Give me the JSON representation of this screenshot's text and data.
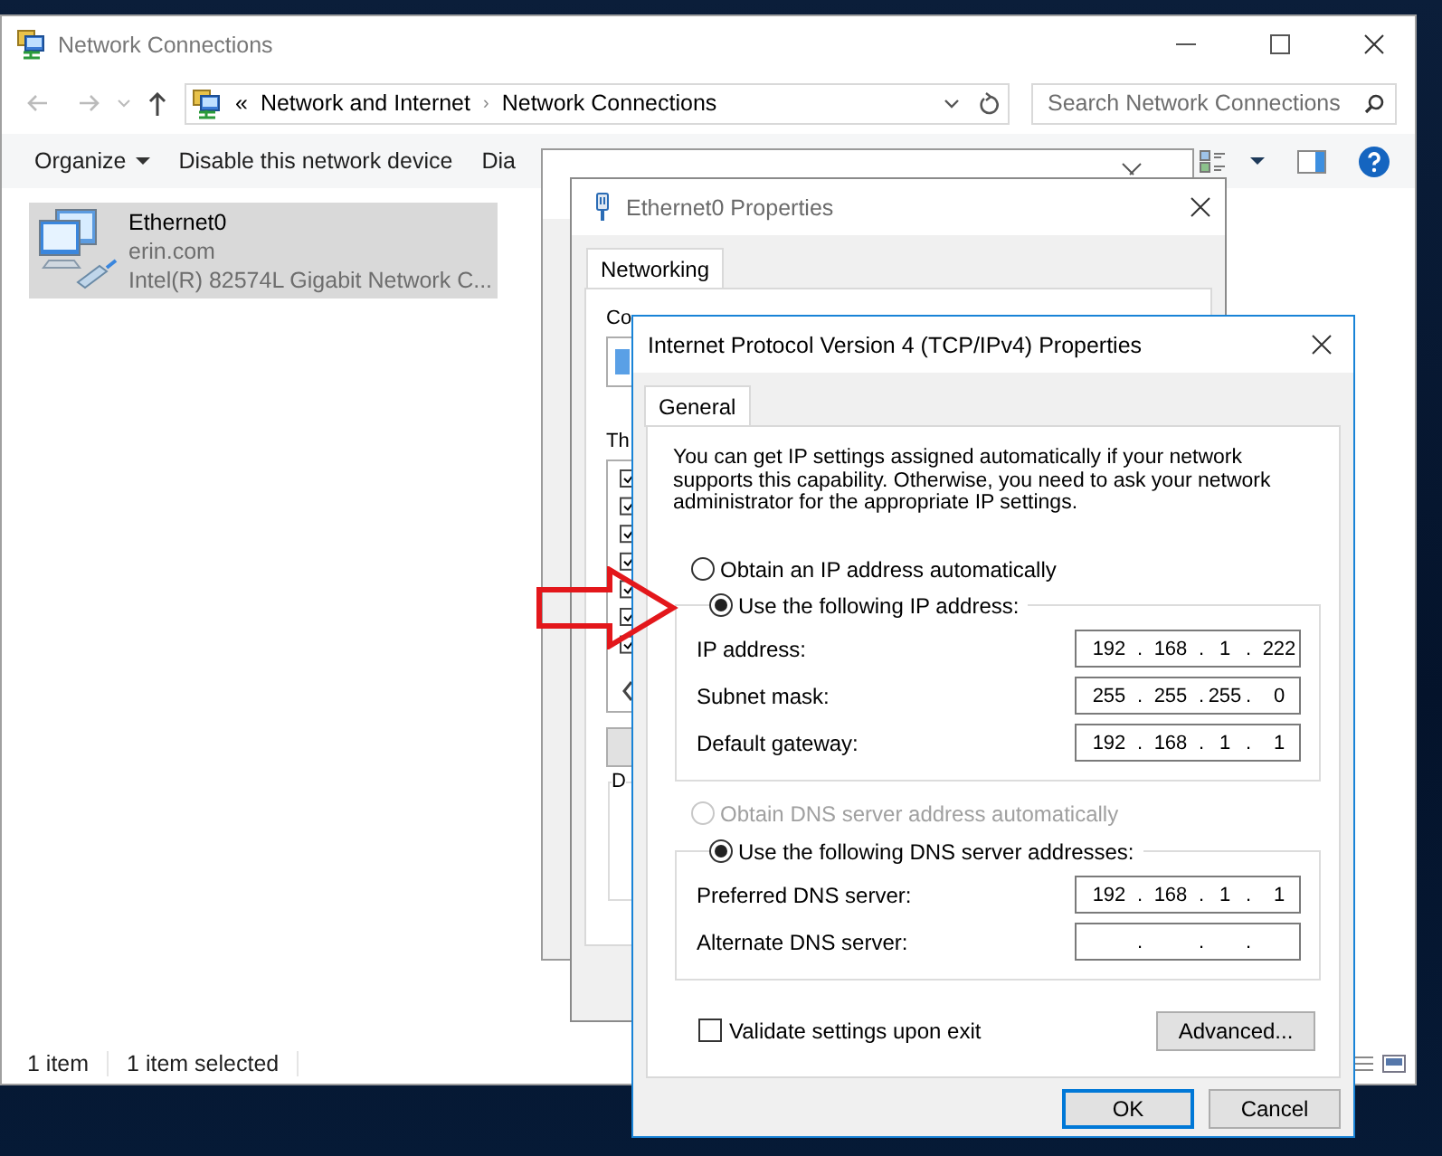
{
  "explorer": {
    "title": "Network Connections",
    "address": {
      "prefix": "«",
      "path": [
        "Network and Internet",
        "Network Connections"
      ],
      "separator": "›"
    },
    "search": {
      "placeholder": "Search Network Connections"
    },
    "toolbar": [
      {
        "label": "Organize",
        "kind": "menu"
      },
      {
        "label": "Disable this network device",
        "kind": "command"
      },
      {
        "label": "Dia",
        "kind": "command"
      }
    ],
    "items": [
      {
        "name": "Ethernet0",
        "domain": "erin.com",
        "adapter": "Intel(R) 82574L Gigabit Network C...",
        "selected": true
      }
    ],
    "status_bar": [
      "1 item",
      "1 item selected"
    ]
  },
  "properties_window": {
    "title": "Ethernet0 Properties",
    "tabs": [
      {
        "label": "Networking",
        "selected": true
      }
    ],
    "connect_label": "Co",
    "items_label": "Th",
    "description_label": "D"
  },
  "ipv4_dialog": {
    "title": "Internet Protocol Version 4 (TCP/IPv4) Properties",
    "tabs": [
      {
        "label": "General",
        "selected": true
      }
    ],
    "description": "You can get IP settings assigned automatically if your network supports this capability. Otherwise, you need to ask your network administrator for the appropriate IP settings.",
    "ip_options": [
      {
        "label": "Obtain an IP address automatically",
        "selected": false,
        "disabled": false
      },
      {
        "label": "Use the following IP address:",
        "selected": true,
        "disabled": false
      }
    ],
    "ip_fields": [
      {
        "label": "IP address:",
        "value": "192 . 168 . 1 . 222"
      },
      {
        "label": "Subnet mask:",
        "value": "255 . 255 . 255 . 0"
      },
      {
        "label": "Default gateway:",
        "value": "192 . 168 . 1 . 1"
      }
    ],
    "dns_options": [
      {
        "label": "Obtain DNS server address automatically",
        "selected": false,
        "disabled": true
      },
      {
        "label": "Use the following DNS server addresses:",
        "selected": true,
        "disabled": false
      }
    ],
    "dns_fields": [
      {
        "label": "Preferred DNS server:",
        "value": "192 . 168 . 1 . 1"
      },
      {
        "label": "Alternate DNS server:",
        "value": ". . ."
      }
    ],
    "validate": {
      "label": "Validate settings upon exit",
      "checked": false
    },
    "advanced_button": "Advanced...",
    "buttons": [
      {
        "label": "OK",
        "default": true
      },
      {
        "label": "Cancel",
        "default": false
      }
    ]
  }
}
